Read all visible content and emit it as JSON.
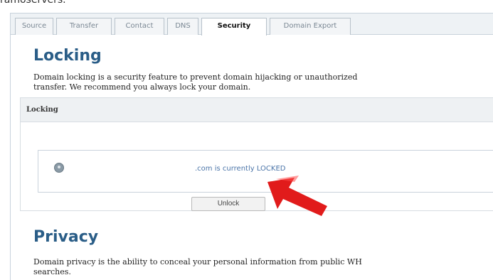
{
  "top_fragment": "ramoservers.",
  "tabs": [
    {
      "label": "Source",
      "active": false
    },
    {
      "label": "Transfer",
      "active": false
    },
    {
      "label": "Contact",
      "active": false
    },
    {
      "label": "DNS",
      "active": false
    },
    {
      "label": "Security",
      "active": true
    },
    {
      "label": "Domain Export",
      "active": false
    }
  ],
  "locking": {
    "title": "Locking",
    "description_line1": "Domain locking is a security feature to prevent domain hijacking or unauthorized",
    "description_line2": "transfer. We recommend you always lock your domain.",
    "panel_header": "Locking",
    "status_text": ".com is currently LOCKED",
    "unlock_button": "Unlock"
  },
  "privacy": {
    "title": "Privacy",
    "description_line1": "Domain privacy is the ability to conceal your personal information from public WH",
    "description_line2": "searches."
  },
  "colors": {
    "heading": "#2a5d87",
    "arrow": "#e11b1b",
    "status_link": "#4a74a8"
  },
  "icons": {
    "info": "info-icon",
    "annotation": "red-arrow-icon"
  }
}
